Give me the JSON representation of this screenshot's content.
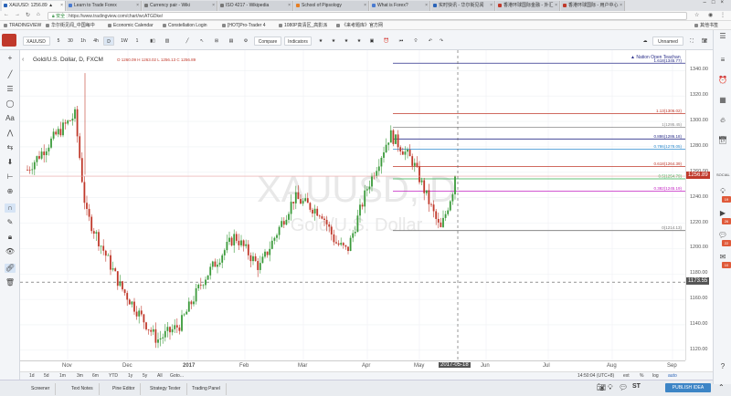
{
  "browser": {
    "tabs": [
      {
        "label": "XAUUSD: 1256.89 ▲"
      },
      {
        "label": "Learn to Trade Forex"
      },
      {
        "label": "Currency pair - Wiki"
      },
      {
        "label": "ISO 4217 - Wikipedia"
      },
      {
        "label": "School of Pipsology"
      },
      {
        "label": "What is Forex?"
      },
      {
        "label": "实时快讯 - 华尔街见闻"
      },
      {
        "label": "香港环球国际金融 - 外汇"
      },
      {
        "label": "香港环球国际 - 用户中心"
      }
    ],
    "security_label": "安全",
    "url": "https://www.tradingview.com/chart/wcATGDke/",
    "bookmarks": [
      "TRADINGVIEW",
      "华尔街见闻_中国每中",
      "Economic Calendar",
      "Constellation Login",
      "[HOT]Pro-Trader 4",
      "1080P高清区_高影派",
      "《来考题库》官方网"
    ],
    "other_bookmarks": "其他书签"
  },
  "toolbar": {
    "symbol": "XAUUSD",
    "intervals": [
      "5",
      "30",
      "1h",
      "4h",
      "D",
      "1W",
      "1"
    ],
    "compare": "Compare",
    "indicators": "Indicators",
    "unnamed": "Unnamed"
  },
  "chart": {
    "legend_title": "Gold/U.S. Dollar, D, FXCM",
    "legend_ohlc": "O 1260.09  H 1263.02  L 1256.13  C 1256.89",
    "watermark_symbol": "XAUUSD, D",
    "watermark_name": "Gold/U.S. Dollar",
    "current_price": "1256.89",
    "crosshair_price": "1173.55",
    "crosshair_date": "2017-05-18",
    "fib_levels": [
      {
        "label": "1.618(1345.77)",
        "color": "#2b2f8a"
      },
      {
        "label": "1.13(1306.02)",
        "color": "#c0392b"
      },
      {
        "label": "1(1295.45)",
        "color": "#888888"
      },
      {
        "label": "0.886(1286.18)",
        "color": "#2b2f8a"
      },
      {
        "label": "0.786(1278.05)",
        "color": "#2f8ccf"
      },
      {
        "label": "0.618(1264.39)",
        "color": "#c0392b"
      },
      {
        "label": "0.5(1254.79)",
        "color": "#2fae4e"
      },
      {
        "label": "0.382(1245.19)",
        "color": "#c21fc2"
      },
      {
        "label": "0(1214.13)",
        "color": "#777777"
      }
    ],
    "annotation": "▲ Nation Open Teachan",
    "price_ticks": [
      "1340.00",
      "1320.00",
      "1300.00",
      "1280.00",
      "1260.00",
      "1240.00",
      "1220.00",
      "1200.00",
      "1180.00",
      "1160.00",
      "1140.00",
      "1120.00"
    ],
    "time_ticks": [
      "Nov",
      "Dec",
      "2017",
      "Feb",
      "Mar",
      "Apr",
      "May",
      "Jun",
      "Jul",
      "Aug",
      "Sep"
    ],
    "up_color": "#3a9a3a",
    "down_color": "#c0392b"
  },
  "chart_data": {
    "type": "candlestick",
    "ylim": [
      1112,
      1356
    ],
    "x": [
      "2016-10",
      "2016-11",
      "2016-12",
      "2017-01",
      "2017-02",
      "2017-03",
      "2017-04",
      "2017-05"
    ],
    "series": [
      {
        "values": [
          1262,
          1228,
          1157,
          1196,
          1250,
          1248,
          1268,
          1256.89
        ]
      }
    ]
  },
  "bottom": {
    "ranges": [
      "1d",
      "5d",
      "1m",
      "3m",
      "6m",
      "YTD",
      "1y",
      "5y",
      "All",
      "Goto..."
    ],
    "clock": "14:50:04 (UTC+8)",
    "scale_opts": [
      "ext",
      "%",
      "log",
      "auto"
    ],
    "tabs": [
      "Screener",
      "Text Notes",
      "Pine Editor",
      "Strategy Tester",
      "Trading Panel"
    ],
    "publish": "PUBLISH IDEA",
    "st": "ST"
  },
  "right": {
    "badges": [
      "19",
      "26",
      "22",
      "10"
    ],
    "social": "SOCIAL"
  }
}
